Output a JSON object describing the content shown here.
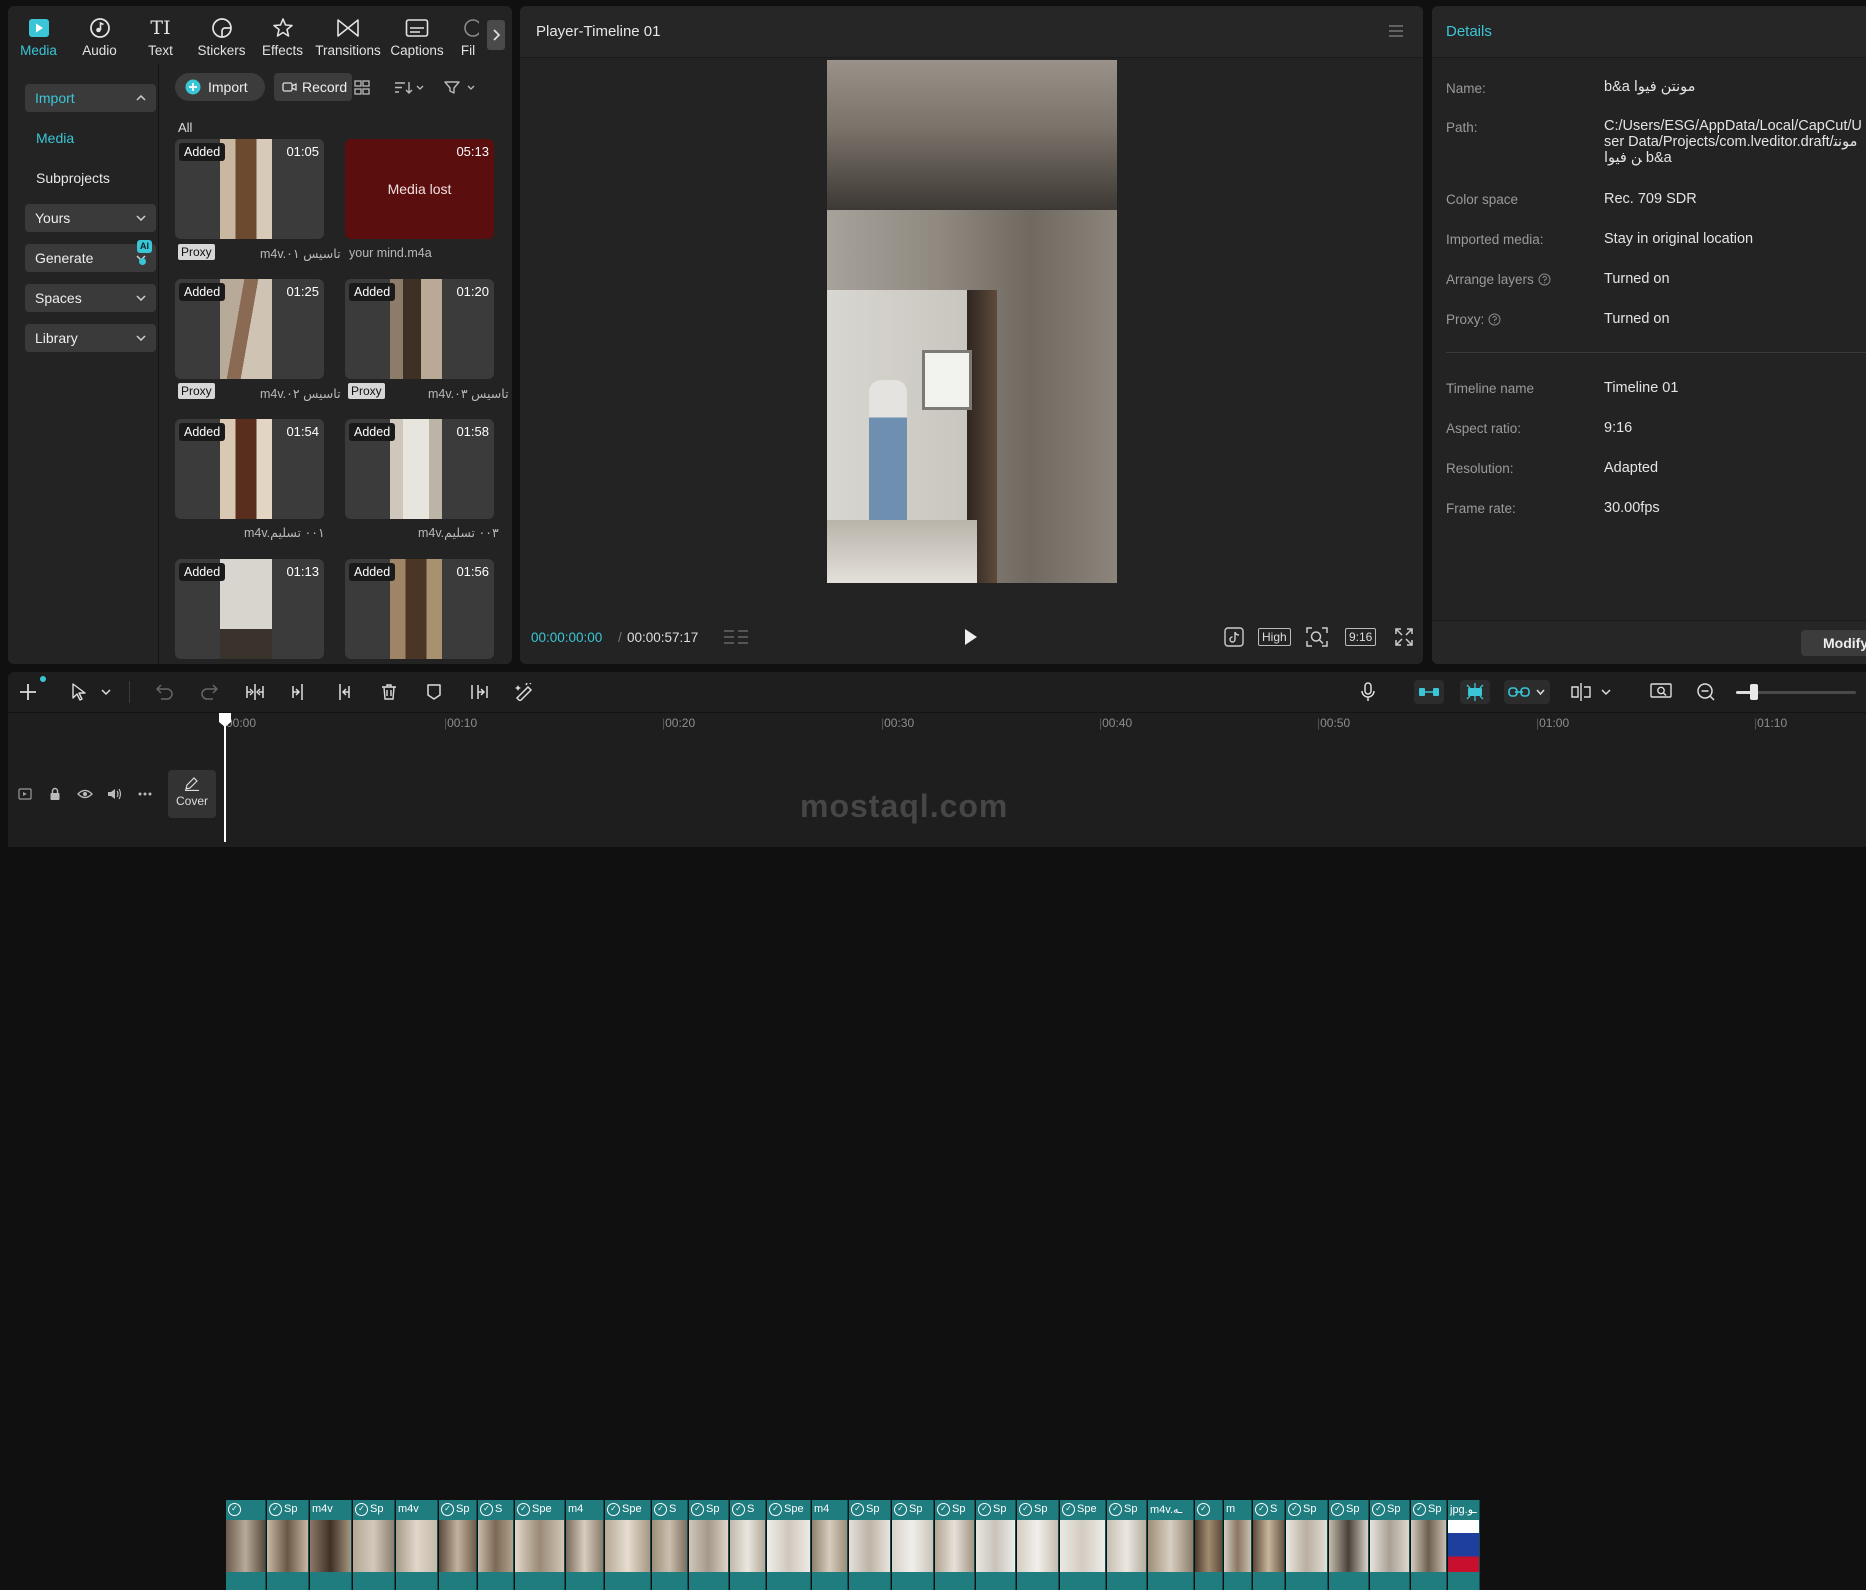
{
  "media_tabs": [
    {
      "label": "Media",
      "icon": "media-icon",
      "active": true
    },
    {
      "label": "Audio",
      "icon": "audio-icon"
    },
    {
      "label": "Text",
      "icon": "text-icon"
    },
    {
      "label": "Stickers",
      "icon": "stickers-icon"
    },
    {
      "label": "Effects",
      "icon": "effects-icon"
    },
    {
      "label": "Transitions",
      "icon": "transitions-icon"
    },
    {
      "label": "Captions",
      "icon": "captions-icon"
    },
    {
      "label": "Fil",
      "icon": "filters-icon"
    }
  ],
  "icons": {
    "tab_glyph": "TI",
    "ai_badge": "AI"
  },
  "sidebar": {
    "import_label": "Import",
    "media_label": "Media",
    "subprojects_label": "Subprojects",
    "yours_label": "Yours",
    "generate_label": "Generate",
    "spaces_label": "Spaces",
    "library_label": "Library"
  },
  "library": {
    "import_button": "Import",
    "record_button": "Record",
    "filter_all": "All",
    "items": [
      {
        "tag": "Added",
        "duration": "01:05",
        "proxy": "Proxy",
        "name": "m4v.تاسيس ٠١"
      },
      {
        "tag": "",
        "duration": "05:13",
        "proxy": "",
        "name": "your mind.m4a",
        "status": "Media lost"
      },
      {
        "tag": "Added",
        "duration": "01:25",
        "proxy": "Proxy",
        "name": "m4v.تاسيس ٠٢"
      },
      {
        "tag": "Added",
        "duration": "01:20",
        "proxy": "Proxy",
        "name": "m4v.تاسيس ٠٣"
      },
      {
        "tag": "Added",
        "duration": "01:54",
        "proxy": "",
        "name": "m4v.٠٠١ تسليم"
      },
      {
        "tag": "Added",
        "duration": "01:58",
        "proxy": "",
        "name": "m4v.٠٠٣ تسليم"
      },
      {
        "tag": "Added",
        "duration": "01:13",
        "proxy": "",
        "name": ""
      },
      {
        "tag": "Added",
        "duration": "01:56",
        "proxy": "",
        "name": ""
      }
    ]
  },
  "player": {
    "title": "Player-Timeline 01",
    "current_time": "00:00:00:00",
    "separator": "/",
    "total_time": "00:00:57:17",
    "quality": "High",
    "ratio": "9:16"
  },
  "details": {
    "title": "Details",
    "rows": [
      {
        "label": "Name:",
        "value": "مونتن فيوا b&a"
      },
      {
        "label": "Path:",
        "value": "C:/Users/ESG/AppData/Local/CapCut/User Data/Projects/com.lveditor.draft/مونتن فيوا b&a"
      },
      {
        "label": "Color space",
        "value": "Rec. 709 SDR"
      },
      {
        "label": "Imported media:",
        "value": "Stay in original location"
      },
      {
        "label": "Arrange layers",
        "value": "Turned on"
      },
      {
        "label": "Proxy:",
        "value": "Turned on"
      },
      {
        "label": "Timeline name",
        "value": "Timeline 01"
      },
      {
        "label": "Aspect ratio:",
        "value": "9:16"
      },
      {
        "label": "Resolution:",
        "value": "Adapted"
      },
      {
        "label": "Frame rate:",
        "value": "30.00fps"
      }
    ],
    "modify_button": "Modify"
  },
  "timeline": {
    "ruler": [
      "00:00",
      "00:10",
      "00:20",
      "00:30",
      "00:40",
      "00:50",
      "01:00",
      "01:10"
    ],
    "cover_label": "Cover",
    "clips": [
      {
        "label": ""
      },
      {
        "label": "Sp"
      },
      {
        "label": "m4v"
      },
      {
        "label": "Sp"
      },
      {
        "label": "m4v"
      },
      {
        "label": "Sp"
      },
      {
        "label": "S"
      },
      {
        "label": "Spe"
      },
      {
        "label": "m4"
      },
      {
        "label": "Spe"
      },
      {
        "label": "S"
      },
      {
        "label": "Sp"
      },
      {
        "label": "S"
      },
      {
        "label": "Spe"
      },
      {
        "label": "m4"
      },
      {
        "label": "Sp"
      },
      {
        "label": "Sp"
      },
      {
        "label": "Sp"
      },
      {
        "label": "Sp"
      },
      {
        "label": "Sp"
      },
      {
        "label": "Spe"
      },
      {
        "label": "Sp"
      },
      {
        "label": "m4v.ـه"
      },
      {
        "label": ""
      },
      {
        "label": "m"
      },
      {
        "label": "S"
      },
      {
        "label": "Sp"
      },
      {
        "label": "Sp"
      },
      {
        "label": "Sp"
      },
      {
        "label": "Sp"
      },
      {
        "label": "jpg.ـو"
      }
    ]
  },
  "watermark": "mostaql.com",
  "colors": {
    "accent": "#3ac6d6",
    "clip": "#1f7d80",
    "lost_media": "#5a0e0e"
  }
}
